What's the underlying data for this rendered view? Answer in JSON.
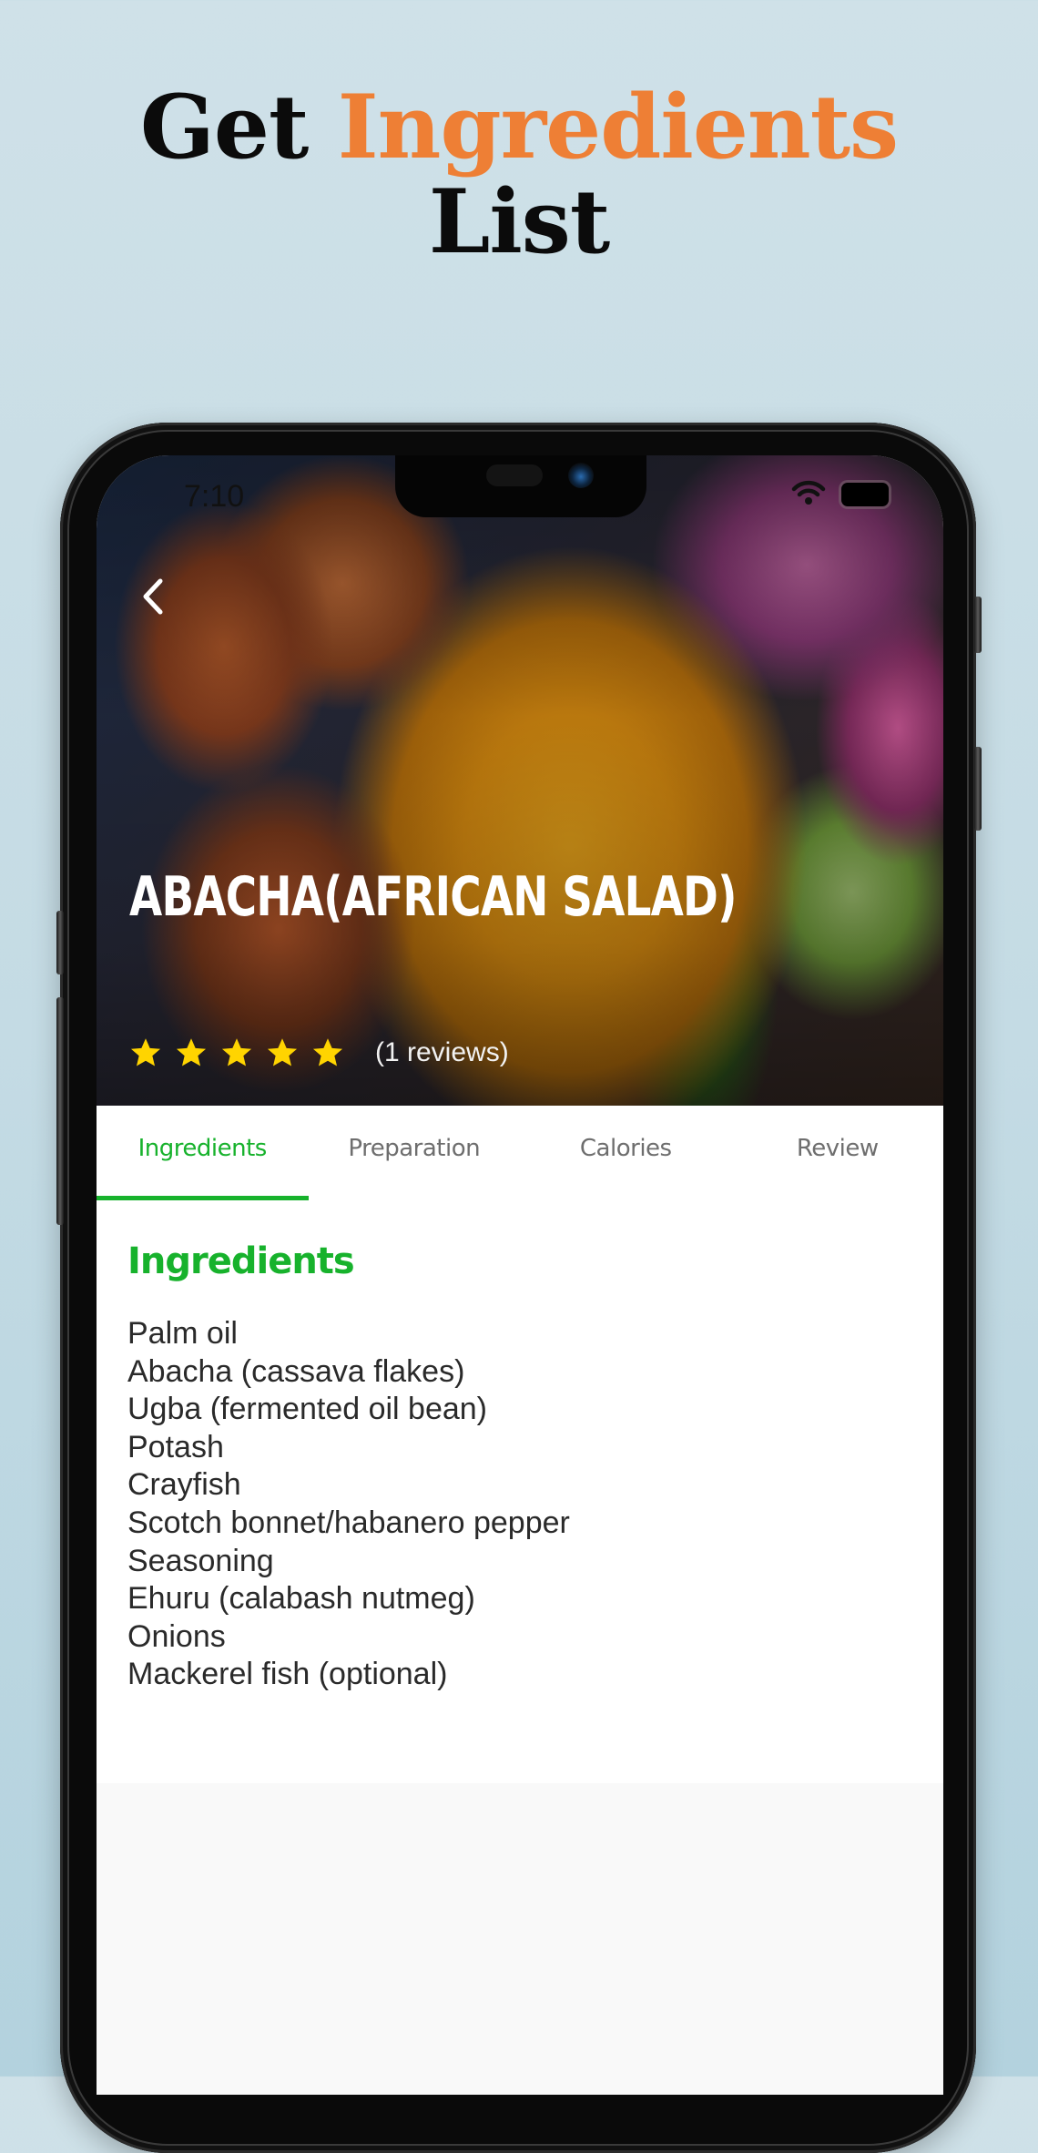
{
  "headline": {
    "prefix": "Get",
    "accent": "Ingredients",
    "suffix": "List",
    "accent_color": "#ee7f35"
  },
  "status_bar": {
    "time": "7:10",
    "icons": [
      "wifi-icon",
      "battery-icon"
    ]
  },
  "recipe": {
    "title": "ABACHA(AFRICAN SALAD)",
    "rating": 5,
    "rating_max": 5,
    "star_color": "#ffd400",
    "reviews_label": "(1 reviews)",
    "back_icon": "chevron-left-icon"
  },
  "tabs": [
    {
      "label": "Ingredients",
      "active": true
    },
    {
      "label": "Preparation",
      "active": false
    },
    {
      "label": "Calories",
      "active": false
    },
    {
      "label": "Review",
      "active": false
    }
  ],
  "accent_green": "#17b22c",
  "ingredients": {
    "title": "Ingredients",
    "items": [
      "Palm oil",
      "Abacha (cassava flakes)",
      "Ugba (fermented oil bean)",
      "Potash",
      "Crayfish",
      "Scotch bonnet/habanero pepper",
      "Seasoning",
      "Ehuru (calabash nutmeg)",
      "Onions",
      "Mackerel fish (optional)"
    ]
  }
}
